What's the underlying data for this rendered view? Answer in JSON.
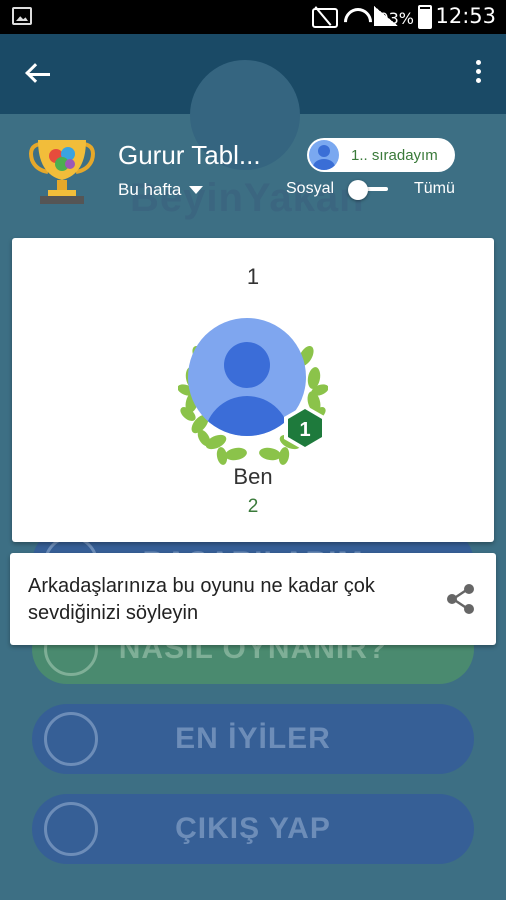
{
  "status_bar": {
    "battery_percent": "93%",
    "time": "12:53"
  },
  "background": {
    "watermark": "BeyinYakan",
    "buttons": [
      "BAŞARILARIM",
      "NASIL OYNANIR?",
      "EN İYİLER",
      "ÇIKIŞ YAP"
    ]
  },
  "header": {
    "title": "Gurur Tabl...",
    "rank_label": "1.. sıradayım",
    "period_label": "Bu hafta",
    "toggle_left": "Sosyal",
    "toggle_right": "Tümü"
  },
  "leaderboard": {
    "rank": "1",
    "badge_rank": "1",
    "player_name": "Ben",
    "player_score": "2"
  },
  "share": {
    "text": "Arkadaşlarınıza bu oyunu ne kadar çok sevdiğinizi söyleyin"
  },
  "colors": {
    "toolbar": "#1a4a66",
    "background": "#3d6f84",
    "score_green": "#3a7a3a",
    "badge_green": "#1e7a3c"
  }
}
